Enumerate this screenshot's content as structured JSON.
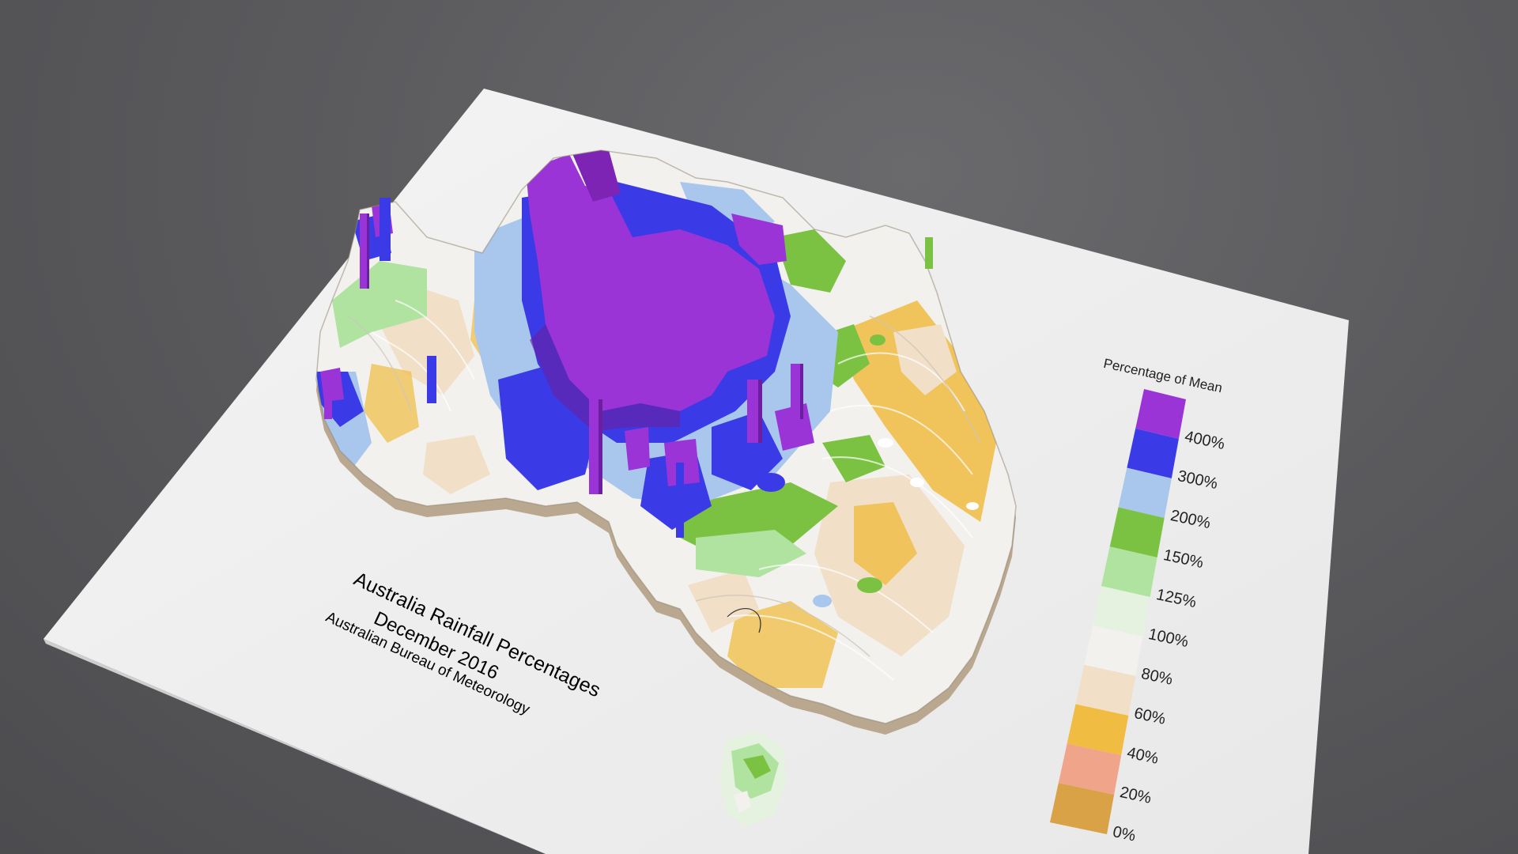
{
  "map": {
    "title": "Australia Rainfall Percentages",
    "subtitle": "December 2016",
    "source": "Australian Bureau of Meteorology"
  },
  "legend": {
    "title": "Percentage of Mean",
    "bands": [
      {
        "lower": "400%",
        "color": "#9b34d6"
      },
      {
        "lower": "300%",
        "color": "#3a3ae6"
      },
      {
        "lower": "200%",
        "color": "#a9c6ec"
      },
      {
        "lower": "150%",
        "color": "#7cc242"
      },
      {
        "lower": "125%",
        "color": "#b0e2a0"
      },
      {
        "lower": "100%",
        "color": "#e4f2df"
      },
      {
        "lower": "80%",
        "color": "#f2f1ee"
      },
      {
        "lower": "60%",
        "color": "#f1dfc7"
      },
      {
        "lower": "40%",
        "color": "#f0bc41"
      },
      {
        "lower": "20%",
        "color": "#f0a48a"
      },
      {
        "lower": "0%",
        "color": "#d9a247"
      }
    ],
    "ticks": [
      "400%",
      "300%",
      "200%",
      "150%",
      "125%",
      "100%",
      "80%",
      "60%",
      "40%",
      "20%",
      "0%"
    ]
  }
}
